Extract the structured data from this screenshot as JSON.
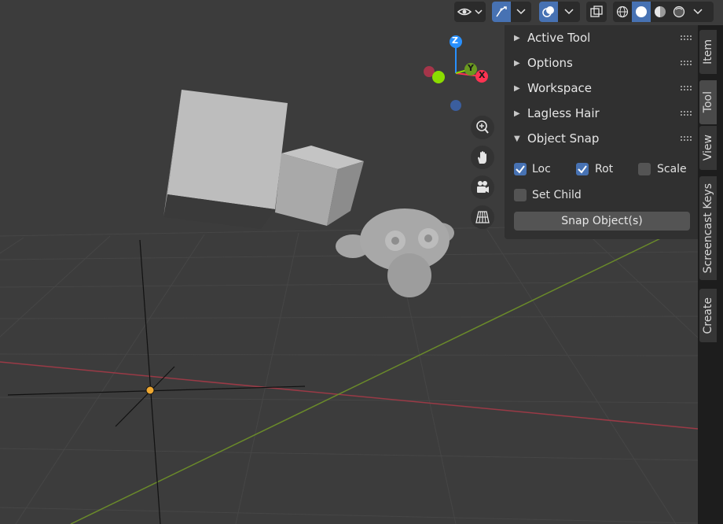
{
  "header": {
    "visibility_icon": "eye-icon",
    "gizmo_icon": "gizmo-icon",
    "overlay_icon": "overlay-icon",
    "xray_icon": "xray-icon",
    "shading_modes": [
      "wireframe",
      "solid",
      "material-preview",
      "rendered"
    ],
    "active_shading": "solid"
  },
  "navigation_gizmo": {
    "axis_z": "Z",
    "axis_y": "Y",
    "axis_x": "X",
    "buttons": [
      "zoom-icon",
      "hand-icon",
      "camera-icon",
      "grid-icon"
    ]
  },
  "sidebar": {
    "sections": [
      {
        "label": "Active Tool",
        "expanded": false
      },
      {
        "label": "Options",
        "expanded": false
      },
      {
        "label": "Workspace",
        "expanded": false
      },
      {
        "label": "Lagless Hair",
        "expanded": false
      },
      {
        "label": "Object Snap",
        "expanded": true
      }
    ],
    "object_snap": {
      "loc": {
        "label": "Loc",
        "checked": true
      },
      "rot": {
        "label": "Rot",
        "checked": true
      },
      "scale": {
        "label": "Scale",
        "checked": false
      },
      "set_child": {
        "label": "Set Child",
        "checked": false
      },
      "button_label": "Snap Object(s)"
    }
  },
  "tabs": [
    {
      "label": "Item",
      "active": false
    },
    {
      "label": "Tool",
      "active": true
    },
    {
      "label": "View",
      "active": false
    },
    {
      "label": "Screencast Keys",
      "active": false
    },
    {
      "label": "Create",
      "active": false
    }
  ],
  "colors": {
    "x_axis": "#ff3352",
    "y_axis": "#8bdc00",
    "z_axis": "#2890ff",
    "accent": "#4772b3",
    "background": "#3c3c3c"
  }
}
